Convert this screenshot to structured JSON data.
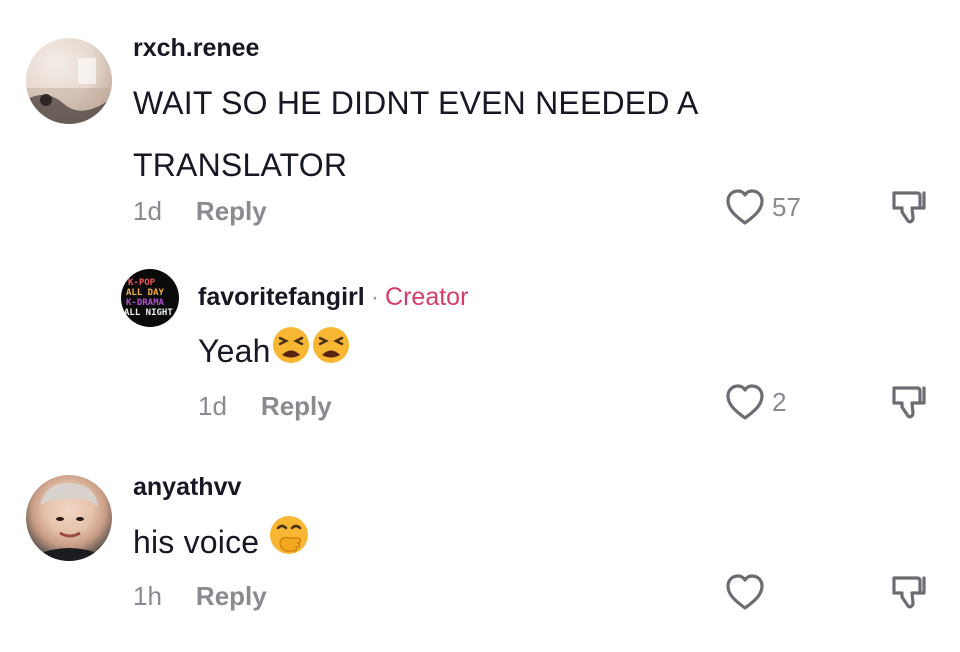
{
  "comments": [
    {
      "username": "rxch.renee",
      "text": "WAIT SO HE DIDNT EVEN NEEDED A TRANSLATOR",
      "age": "1d",
      "reply_label": "Reply",
      "likes": "57",
      "avatar_icon": "profile-photo-avatar"
    },
    {
      "username": "favoritefangirl",
      "separator": "·",
      "badge": "Creator",
      "text": "Yeah",
      "emojis": [
        "tired-face-emoji",
        "tired-face-emoji"
      ],
      "age": "1d",
      "reply_label": "Reply",
      "likes": "2",
      "avatar_logo_text": [
        "K-POP",
        "ALL DAY",
        "K-DRAMA",
        "ALL NIGHT"
      ]
    },
    {
      "username": "anyathvv",
      "text": "his voice",
      "emojis": [
        "face-with-hand-over-mouth-emoji"
      ],
      "age": "1h",
      "reply_label": "Reply",
      "likes": "",
      "avatar_icon": "profile-photo-avatar"
    }
  ],
  "colors": {
    "primary_text": "#161823",
    "secondary_text": "#8a8b91",
    "creator_badge": "#d43d6a"
  }
}
